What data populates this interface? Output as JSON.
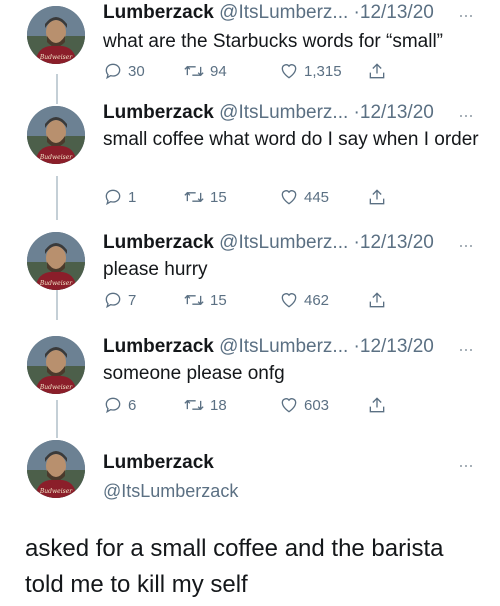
{
  "thread": [
    {
      "name": "Lumberzack",
      "handle": "@ItsLumberz...",
      "date": "·12/13/20",
      "text": "what are the Starbucks words for “small”",
      "replies": "30",
      "retweets": "94",
      "likes": "1,315"
    },
    {
      "name": "Lumberzack",
      "handle": "@ItsLumberz...",
      "date": "·12/13/20",
      "text": "small coffee what word do I say when I order",
      "replies": "1",
      "retweets": "15",
      "likes": "445"
    },
    {
      "name": "Lumberzack",
      "handle": "@ItsLumberz...",
      "date": "·12/13/20",
      "text": "please hurry",
      "replies": "7",
      "retweets": "15",
      "likes": "462"
    },
    {
      "name": "Lumberzack",
      "handle": "@ItsLumberz...",
      "date": "·12/13/20",
      "text": "someone please onfg",
      "replies": "6",
      "retweets": "18",
      "likes": "603"
    }
  ],
  "final": {
    "name": "Lumberzack",
    "handle": "@ItsLumberzack",
    "text": "asked for a small coffee and the barista told me to kill my self"
  },
  "more_glyph": "···",
  "avatar_shirt_text": "Budweiser",
  "colors": {
    "text": "#14171a",
    "muted": "#5b7083",
    "thread_line": "#c4cfd6",
    "avatar_bg": "#5a6f80",
    "shirt": "#8b1e2a"
  },
  "icons": [
    "reply-icon",
    "retweet-icon",
    "like-icon",
    "share-icon",
    "more-icon"
  ]
}
